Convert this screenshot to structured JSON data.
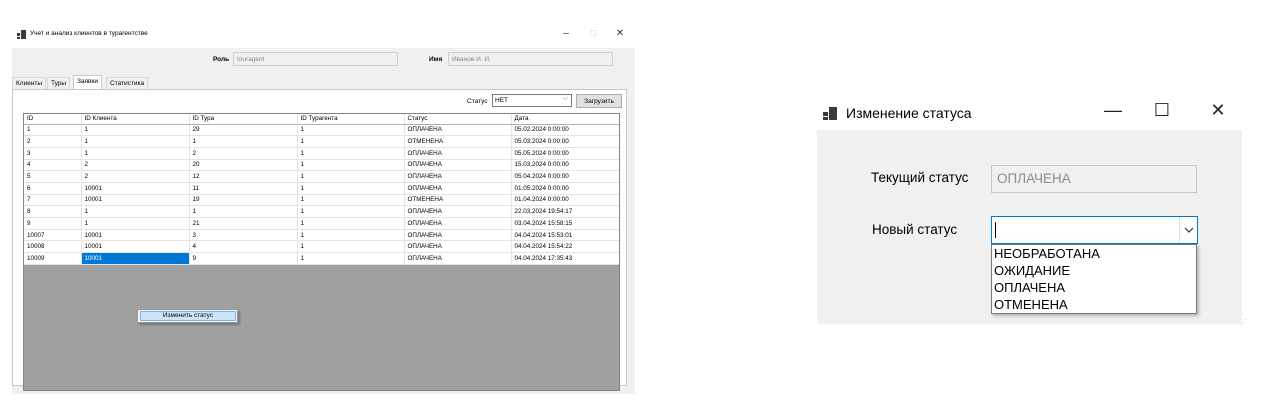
{
  "main_window": {
    "title": "Учет и анализ клиентов в турагентстве",
    "controls": {
      "minimize": "–",
      "maximize": "□",
      "close": "✕"
    },
    "role_label": "Роль",
    "role_value": "touragent",
    "name_label": "Имя",
    "name_value": "Иванов И. И.",
    "tabs": [
      {
        "label": "Клиенты",
        "active": false
      },
      {
        "label": "Туры",
        "active": false
      },
      {
        "label": "Заявки",
        "active": true
      },
      {
        "label": "Статистика",
        "active": false
      }
    ],
    "status_filter_label": "Статус",
    "status_filter_value": "НЕТ",
    "load_button": "Загрузить",
    "grid": {
      "columns": [
        "ID",
        "ID Клиента",
        "ID Тура",
        "ID Турагента",
        "Статус",
        "Дата"
      ],
      "rows": [
        [
          "1",
          "1",
          "29",
          "1",
          "ОПЛАЧЕНА",
          "05.02.2024 0:00:00"
        ],
        [
          "2",
          "1",
          "1",
          "1",
          "ОТМЕНЕНА",
          "05.03.2024 0:00:00"
        ],
        [
          "3",
          "1",
          "2",
          "1",
          "ОПЛАЧЕНА",
          "05.05.2024 0:00:00"
        ],
        [
          "4",
          "2",
          "20",
          "1",
          "ОПЛАЧЕНА",
          "15.03.2024 0:00:00"
        ],
        [
          "5",
          "2",
          "12",
          "1",
          "ОПЛАЧЕНА",
          "05.04.2024 0:00:00"
        ],
        [
          "6",
          "10001",
          "11",
          "1",
          "ОПЛАЧЕНА",
          "01.05.2024 0:00:00"
        ],
        [
          "7",
          "10001",
          "19",
          "1",
          "ОТМЕНЕНА",
          "01.04.2024 0:00:00"
        ],
        [
          "8",
          "1",
          "1",
          "1",
          "ОПЛАЧЕНА",
          "22.03.2024 19:54:17"
        ],
        [
          "9",
          "1",
          "21",
          "1",
          "ОПЛАЧЕНА",
          "03.04.2024 15:58:15"
        ],
        [
          "10007",
          "10001",
          "3",
          "1",
          "ОПЛАЧЕНА",
          "04.04.2024 15:53:01"
        ],
        [
          "10008",
          "10001",
          "4",
          "1",
          "ОПЛАЧЕНА",
          "04.04.2024 15:54:22"
        ],
        [
          "10009",
          "10001",
          "9",
          "1",
          "ОПЛАЧЕНА",
          "04.04.2024 17:35:43"
        ]
      ],
      "selected_cell": {
        "row": 11,
        "col": 1
      }
    },
    "context_menu": {
      "items": [
        "Изменить статус"
      ]
    }
  },
  "dialog": {
    "title": "Изменение статуса",
    "controls": {
      "minimize": "—",
      "maximize": "☐",
      "close": "✕"
    },
    "current_status_label": "Текущий статус",
    "current_status_value": "ОПЛАЧЕНА",
    "new_status_label": "Новый статус",
    "new_status_value": "",
    "dropdown_options": [
      "НЕОБРАБОТАНА",
      "ОЖИДАНИЕ",
      "ОПЛАЧЕНА",
      "ОТМЕНЕНА"
    ]
  },
  "colors": {
    "selection": "#0078d7",
    "window_bg": "#f0f0f0",
    "grid_background": "#a0a0a0",
    "menu_highlight": "#cce4f7"
  }
}
